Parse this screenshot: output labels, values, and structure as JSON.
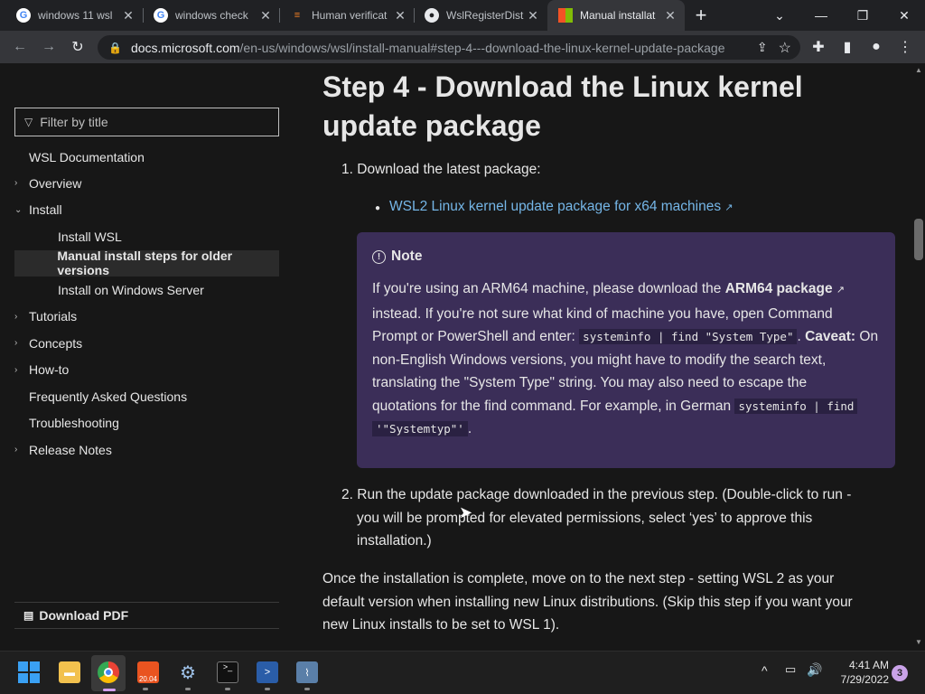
{
  "browser": {
    "tabs": [
      {
        "title": "windows 11 wsl",
        "icon": "google-icon"
      },
      {
        "title": "windows check",
        "icon": "google-icon"
      },
      {
        "title": "Human verificat",
        "icon": "stackoverflow-icon"
      },
      {
        "title": "WslRegisterDist",
        "icon": "github-icon"
      },
      {
        "title": "Manual installat",
        "icon": "microsoft-icon",
        "active": true
      }
    ],
    "new_tab": "+",
    "url_host": "docs.microsoft.com",
    "url_path": "/en-us/windows/wsl/install-manual#step-4---download-the-linux-kernel-update-package"
  },
  "sidebar": {
    "filter_placeholder": "Filter by title",
    "items": [
      {
        "label": "WSL Documentation",
        "level": 0,
        "chevron": ""
      },
      {
        "label": "Overview",
        "level": 0,
        "chevron": "›"
      },
      {
        "label": "Install",
        "level": 0,
        "chevron": "⌄"
      },
      {
        "label": "Install WSL",
        "level": 1,
        "chevron": ""
      },
      {
        "label": "Manual install steps for older versions",
        "level": 1,
        "chevron": "",
        "selected": true
      },
      {
        "label": "Install on Windows Server",
        "level": 1,
        "chevron": ""
      },
      {
        "label": "Tutorials",
        "level": 0,
        "chevron": "›"
      },
      {
        "label": "Concepts",
        "level": 0,
        "chevron": "›"
      },
      {
        "label": "How-to",
        "level": 0,
        "chevron": "›"
      },
      {
        "label": "Frequently Asked Questions",
        "level": 0,
        "chevron": ""
      },
      {
        "label": "Troubleshooting",
        "level": 0,
        "chevron": ""
      },
      {
        "label": "Release Notes",
        "level": 0,
        "chevron": "›"
      }
    ],
    "download_pdf": "Download PDF"
  },
  "main": {
    "heading_line1": "Step 4 - Download the Linux kernel",
    "heading_line2": "update package",
    "step1_number": "1.",
    "step1": "Download the latest package:",
    "bullet_link": "WSL2 Linux kernel update package for x64 machines",
    "note": {
      "title": "Note",
      "t1": "If you're using an ARM64 machine, please download the ",
      "arm_link": "ARM64 package",
      "t2": "instead. If you're not sure what kind of machine you have, open Command",
      "t3": "Prompt or PowerShell and enter: ",
      "code1": "systeminfo | find \"System Type\"",
      "t4": ". ",
      "caveat": "Caveat:",
      "t5": " On",
      "t6": "non-English Windows versions, you might have to modify the search text,",
      "t7": "translating the \"System Type\" string. You may also need to escape the",
      "t8": "quotations for the find command. For example, in German ",
      "code2": "systeminfo | find",
      "code3": "'\"Systemtyp\"'",
      "t9": "."
    },
    "step2_number": "2.",
    "step2_line1": "Run the update package downloaded in the previous step. (Double-click to run -",
    "step2_line2": "you will be prompted for elevated permissions, select ‘yes’ to approve this",
    "step2_line3": "installation.)",
    "para_line1": "Once the installation is complete, move on to the next step - setting WSL 2 as your",
    "para_line2": "default version when installing new Linux distributions. (Skip this step if you want your",
    "para_line3": "new Linux installs to be set to WSL 1)."
  },
  "taskbar": {
    "time": "4:41 AM",
    "date": "7/29/2022",
    "notifications": "3",
    "badge_ubuntu": "20.04"
  },
  "colors": {
    "accent_link": "#75b6e7",
    "note_bg": "#3b2e58"
  }
}
